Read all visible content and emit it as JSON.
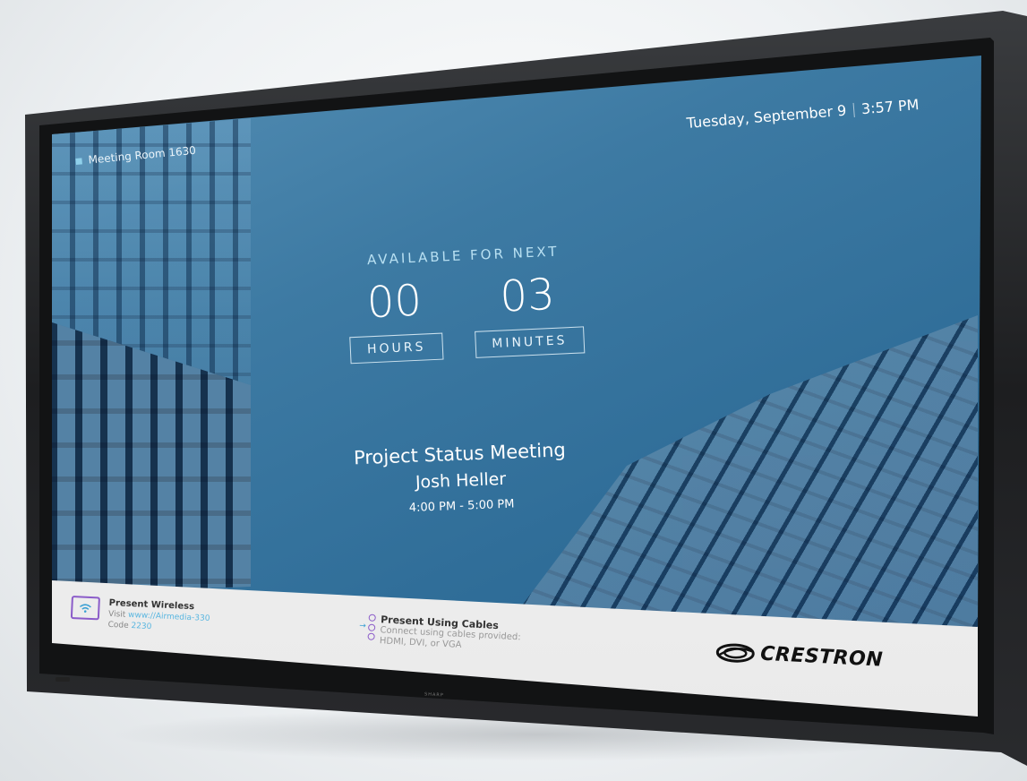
{
  "header": {
    "room_name": "Meeting Room 1630",
    "date": "Tuesday, September 9",
    "time": "3:57 PM"
  },
  "availability": {
    "label": "AVAILABLE FOR NEXT",
    "hours_value": "00",
    "hours_label": "HOURS",
    "minutes_value": "03",
    "minutes_label": "MINUTES"
  },
  "next_meeting": {
    "title": "Project Status Meeting",
    "organizer": "Josh Heller",
    "time_range": "4:00 PM - 5:00 PM"
  },
  "present_wireless": {
    "title": "Present Wireless",
    "visit_prefix": "Visit",
    "url": "www://Airmedia-330",
    "code_prefix": "Code",
    "code": "2230"
  },
  "present_cables": {
    "title": "Present Using Cables",
    "line1": "Connect using cables provided:",
    "line2": "HDMI, DVI, or VGA"
  },
  "brand": {
    "logo_text": "CRESTRON",
    "bezel_brand": "SHARP"
  },
  "colors": {
    "screen_blue": "#3d7aa3",
    "accent_purple": "#8b5cc9",
    "link_blue": "#59b6e0",
    "label_cyan": "#b8e0f2"
  },
  "icons": {
    "wireless": "wifi-screen-icon",
    "cables": "cable-connector-icon",
    "room": "room-square-icon",
    "logo": "crestron-swirl-icon"
  }
}
